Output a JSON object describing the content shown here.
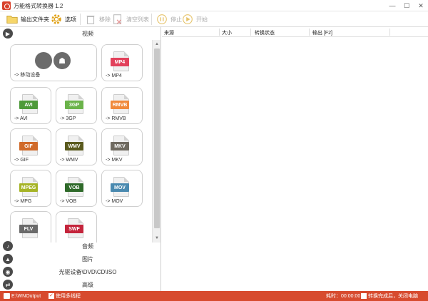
{
  "app": {
    "title": "万能格式转换器 1.2"
  },
  "toolbar": {
    "output_folder": "输出文件夹",
    "options": "选项",
    "remove": "移除",
    "clear_list": "清空列表",
    "stop": "停止",
    "start": "开始"
  },
  "categories": {
    "video": "视频",
    "audio": "音频",
    "image": "图片",
    "disc": "光驱设备\\DVD\\CD\\ISO",
    "advanced": "高级"
  },
  "formats": [
    {
      "label": "-> 移动设备",
      "tag": "",
      "color": "#6b6b6b"
    },
    {
      "label": "-> MP4",
      "tag": "MP4",
      "color": "#e2415b"
    },
    {
      "label": "-> AVI",
      "tag": "AVI",
      "color": "#4e9a3a"
    },
    {
      "label": "-> 3GP",
      "tag": "3GP",
      "color": "#6bb34a"
    },
    {
      "label": "-> RMVB",
      "tag": "RMVB",
      "color": "#f08a3c"
    },
    {
      "label": "-> GIF",
      "tag": "GIF",
      "color": "#d06a2a"
    },
    {
      "label": "-> WMV",
      "tag": "WMV",
      "color": "#5a5a1e"
    },
    {
      "label": "-> MKV",
      "tag": "MKV",
      "color": "#6f6a60"
    },
    {
      "label": "-> MPG",
      "tag": "MPEG",
      "color": "#a6b426"
    },
    {
      "label": "-> VOB",
      "tag": "VOB",
      "color": "#2f6a2a"
    },
    {
      "label": "-> MOV",
      "tag": "MOV",
      "color": "#4a8ab0"
    },
    {
      "label": "",
      "tag": "FLV",
      "color": "#6a6a6a"
    },
    {
      "label": "",
      "tag": "SWF",
      "color": "#c4243b"
    }
  ],
  "list": {
    "columns": [
      "来源",
      "大小",
      "转换状态",
      "输出 [F2]"
    ]
  },
  "status": {
    "output_path": "E:\\WNOutput",
    "multithread": "使用多线程",
    "elapsed": "耗时：00:00:00",
    "shutdown": "转换完成后，关闭电脑"
  },
  "colors": {
    "accent": "#d74b2f"
  }
}
